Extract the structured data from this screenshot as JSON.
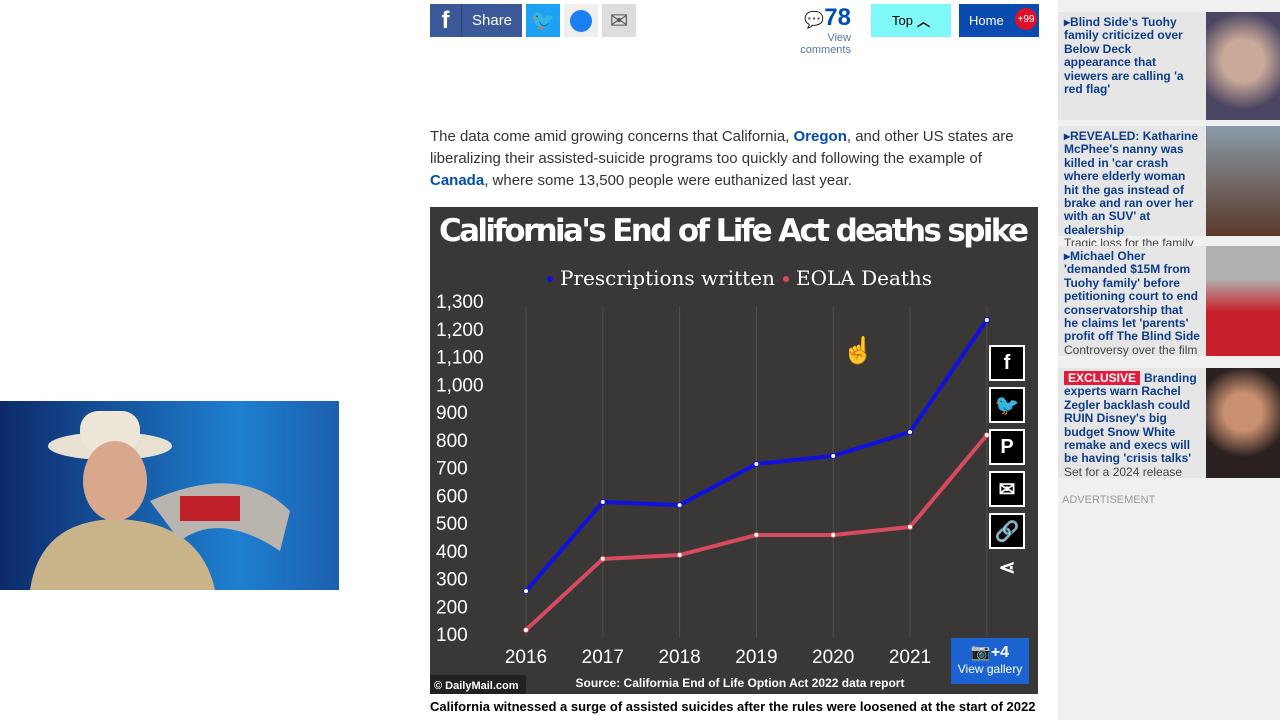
{
  "share_bar": {
    "share_label": "Share",
    "comments_count": "78",
    "comments_label": "View comments",
    "top_label": "Top",
    "home_label": "Home",
    "home_badge": "+99"
  },
  "article": {
    "para_parts": [
      "The data come amid growing concerns that California, ",
      "Oregon",
      ", and other US states are liberalizing their assisted-suicide programs too quickly and following the example of ",
      "Canada",
      ", where some 13,500 people were euthanized last year."
    ],
    "caption": "California witnessed a surge of assisted suicides after the rules were loosened at the start of 2022"
  },
  "chart_data": {
    "type": "line",
    "title": "California's End of Life Act deaths spike",
    "categories": [
      "2016",
      "2017",
      "2018",
      "2019",
      "2020",
      "2021",
      "2022"
    ],
    "series": [
      {
        "name": "Prescriptions written",
        "color": "#1010e0",
        "values": [
          251,
          572,
          561,
          709,
          738,
          824,
          1228
        ]
      },
      {
        "name": "EOLA Deaths",
        "color": "#d84a60",
        "values": [
          111,
          367,
          381,
          453,
          453,
          482,
          813
        ]
      }
    ],
    "yticks": [
      "100",
      "200",
      "300",
      "400",
      "500",
      "600",
      "700",
      "800",
      "900",
      "1,000",
      "1,100",
      "1,200",
      "1,300"
    ],
    "ylim": [
      100,
      1300
    ],
    "source": "Source: California End of Life Option Act 2022 data report",
    "credit": "© DailyMail.com",
    "gallery_count": "+4",
    "gallery_label": "View gallery"
  },
  "sidebar": {
    "items": [
      {
        "title": "Blind Side's Tuohy family criticized over Below Deck appearance that viewers are calling 'a red flag'",
        "sub": ""
      },
      {
        "title": "REVEALED: Katharine McPhee's nanny was killed in 'car crash where elderly woman hit the gas instead of brake and ran over her with an SUV' at dealership",
        "sub": "Tragic loss for the family"
      },
      {
        "title": "Michael Oher 'demanded $15M from Tuohy family' before petitioning court to end conservatorship that he claims let 'parents' profit off The Blind Side",
        "sub": "Controversy over the film"
      },
      {
        "tag": "EXCLUSIVE",
        "title": "Branding experts warn Rachel Zegler backlash could RUIN Disney's big budget Snow White remake and execs will be having 'crisis talks'",
        "sub": "Set for a 2024 release"
      }
    ],
    "ad_label": "ADVERTISEMENT"
  }
}
